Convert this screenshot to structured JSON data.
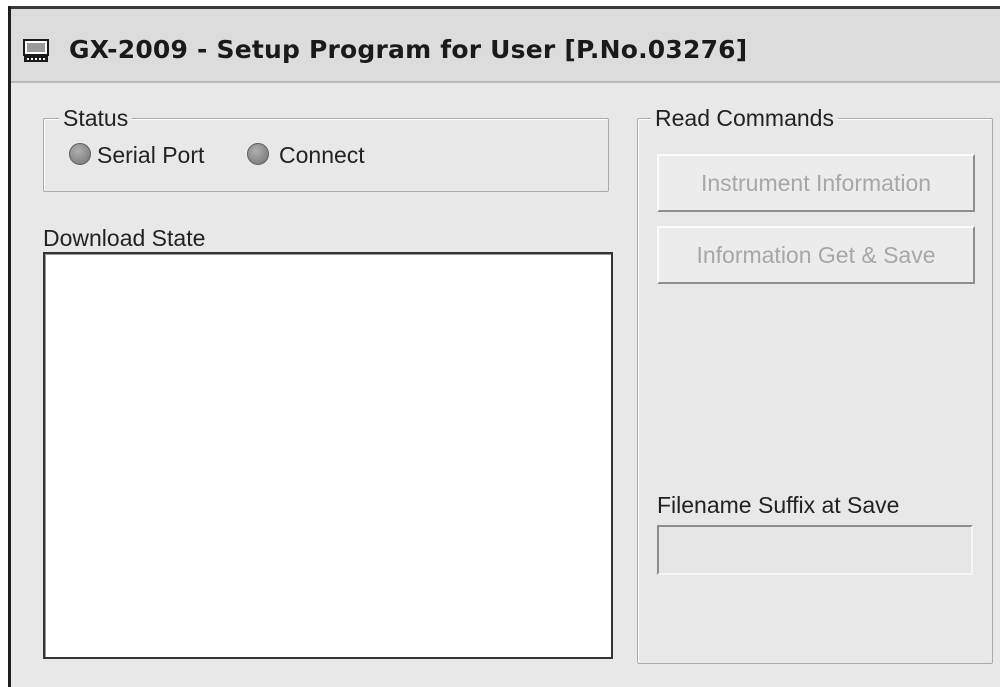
{
  "window": {
    "title": "GX-2009 - Setup Program for User [P.No.03276]",
    "icon": "app-window-icon"
  },
  "status": {
    "legend": "Status",
    "serial_port_label": "Serial Port",
    "connect_label": "Connect",
    "led_color": "#8d8d8d"
  },
  "download": {
    "label": "Download State",
    "items": []
  },
  "read_commands": {
    "legend": "Read Commands",
    "instrument_information_label": "Instrument Information",
    "information_get_save_label": "Information Get & Save"
  },
  "filename": {
    "label": "Filename Suffix at Save",
    "value": "",
    "placeholder": ""
  },
  "colors": {
    "window_bg": "#e8e8e8",
    "disabled_text": "#a7a7a7"
  }
}
